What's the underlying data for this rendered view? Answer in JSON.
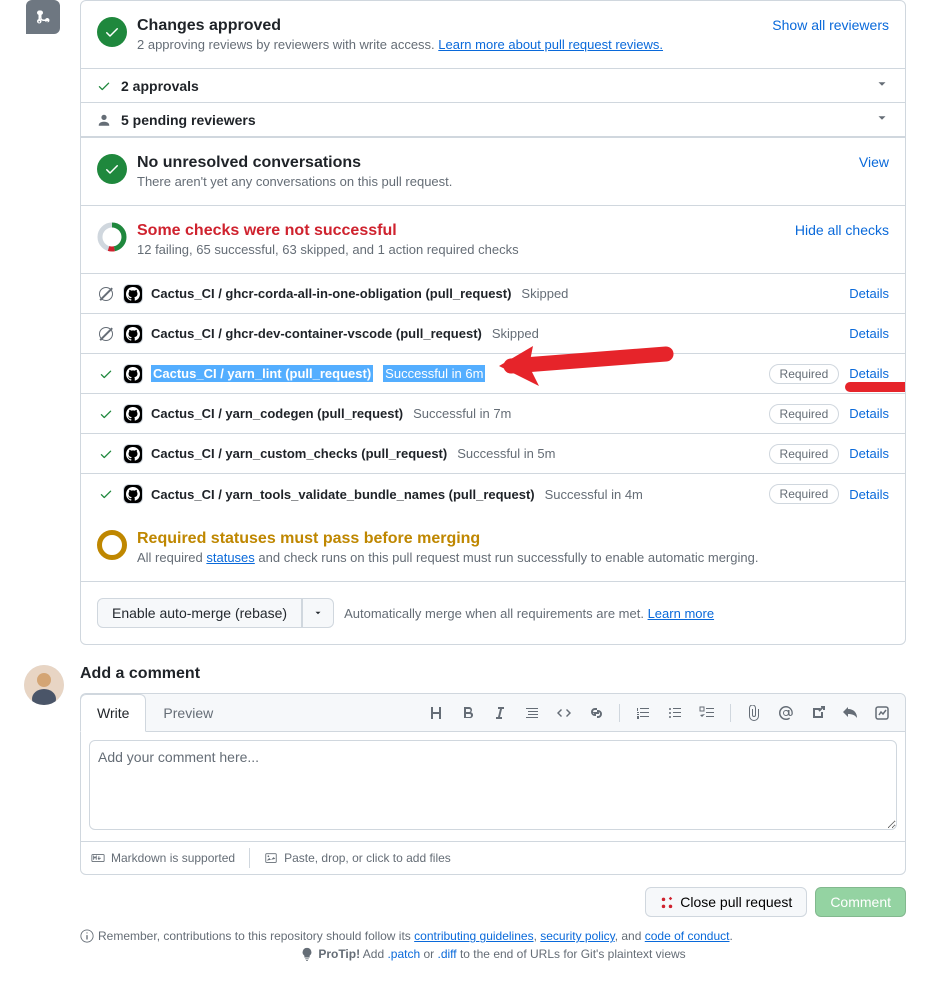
{
  "approval": {
    "title": "Changes approved",
    "sub": "2 approving reviews by reviewers with write access. ",
    "learn": "Learn more about pull request reviews.",
    "show_all": "Show all reviewers",
    "approvals_count": "2 approvals",
    "pending": "5 pending reviewers"
  },
  "conversations": {
    "title": "No unresolved conversations",
    "sub": "There aren't yet any conversations on this pull request.",
    "view": "View"
  },
  "checks_summary": {
    "title": "Some checks were not successful",
    "sub": "12 failing, 65 successful, 63 skipped, and 1 action required checks",
    "hide": "Hide all checks"
  },
  "checks": [
    {
      "status": "skip",
      "name": "Cactus_CI / ghcr-corda-all-in-one-obligation (pull_request)",
      "result": "Skipped",
      "required": false,
      "details": "Details",
      "highlighted": false
    },
    {
      "status": "skip",
      "name": "Cactus_CI / ghcr-dev-container-vscode (pull_request)",
      "result": "Skipped",
      "required": false,
      "details": "Details",
      "highlighted": false
    },
    {
      "status": "pass",
      "name": "Cactus_CI / yarn_lint (pull_request)",
      "result": "Successful in 6m",
      "required": true,
      "details": "Details",
      "highlighted": true
    },
    {
      "status": "pass",
      "name": "Cactus_CI / yarn_codegen (pull_request)",
      "result": "Successful in 7m",
      "required": true,
      "details": "Details",
      "highlighted": false
    },
    {
      "status": "pass",
      "name": "Cactus_CI / yarn_custom_checks (pull_request)",
      "result": "Successful in 5m",
      "required": true,
      "details": "Details",
      "highlighted": false
    },
    {
      "status": "pass",
      "name": "Cactus_CI / yarn_tools_validate_bundle_names (pull_request)",
      "result": "Successful in 4m",
      "required": true,
      "details": "Details",
      "highlighted": false
    }
  ],
  "required_status": {
    "title": "Required statuses must pass before merging",
    "prefix": "All required ",
    "statuses": "statuses",
    "suffix": " and check runs on this pull request must run successfully to enable automatic merging."
  },
  "merge": {
    "enable": "Enable auto-merge (rebase)",
    "text": "Automatically merge when all requirements are met. ",
    "learn": "Learn more"
  },
  "comment": {
    "title": "Add a comment",
    "tab_write": "Write",
    "tab_preview": "Preview",
    "placeholder": "Add your comment here...",
    "md_support": "Markdown is supported",
    "paste": "Paste, drop, or click to add files"
  },
  "actions": {
    "close": "Close pull request",
    "comment": "Comment"
  },
  "footer": {
    "remember_prefix": "Remember, contributions to this repository should follow its ",
    "guidelines": "contributing guidelines",
    "comma1": ", ",
    "security": "security policy",
    "comma2": ", and ",
    "coc": "code of conduct",
    "period": ".",
    "protip": "ProTip!",
    "protip_prefix": " Add ",
    "patch": ".patch",
    "or": " or ",
    "diff": ".diff",
    "protip_suffix": " to the end of URLs for Git's plaintext views"
  },
  "required_label": "Required"
}
